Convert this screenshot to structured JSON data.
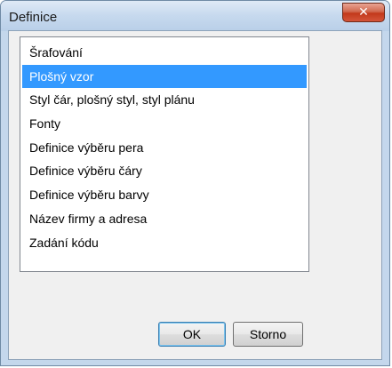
{
  "window": {
    "title": "Definice"
  },
  "list": {
    "items": [
      "Šrafování",
      "Plošný vzor",
      "Styl čár, plošný styl, styl plánu",
      "Fonty",
      "Definice výběru pera",
      "Definice výběru čáry",
      "Definice výběru barvy",
      "Název firmy a adresa",
      "Zadání kódu"
    ],
    "selected": "Plošný vzor"
  },
  "buttons": {
    "ok": "OK",
    "cancel": "Storno"
  }
}
